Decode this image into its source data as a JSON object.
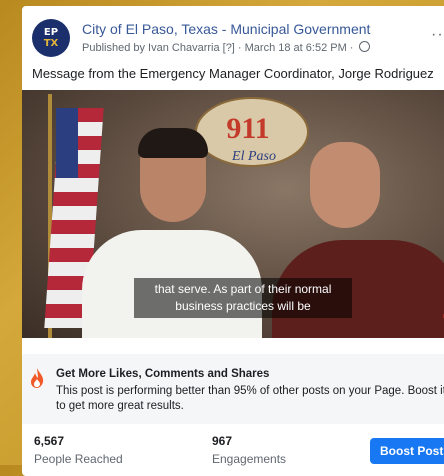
{
  "post": {
    "page_name": "City of El Paso, Texas - Municipal Government",
    "avatar_line1": "EP",
    "avatar_line2": "TX",
    "meta": "Published by Ivan Chavarria [?] · March 18 at 6:52 PM ·",
    "more": "···",
    "message": "Message from the Emergency Manager Coordinator, Jorge Rodriguez"
  },
  "video": {
    "caption_line1": "that serve. As part of their normal",
    "caption_line2": "business practices will be",
    "logo_text": "911",
    "logo_sub": "El Paso"
  },
  "boost": {
    "title": "Get More Likes, Comments and Shares",
    "description": "This post is performing better than 95% of other posts on your Page. Boost it to get more great results."
  },
  "stats": {
    "reached_value": "6,567",
    "reached_label": "People Reached",
    "engagements_value": "967",
    "engagements_label": "Engagements",
    "boost_button": "Boost Post"
  },
  "colors": {
    "accent": "#1877f2",
    "link": "#385898",
    "background": "#c79a2c"
  }
}
